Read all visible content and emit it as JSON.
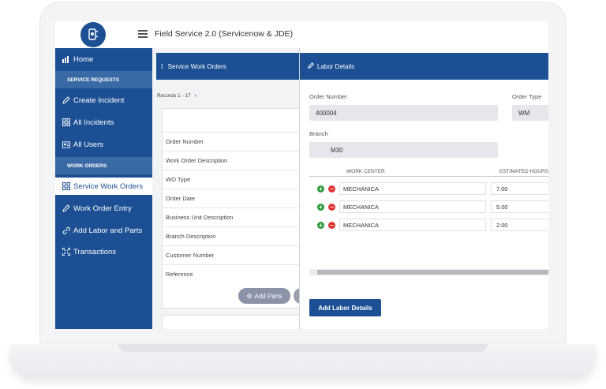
{
  "app": {
    "title": "Field Service 2.0 (Servicenow & JDE)"
  },
  "sidebar": {
    "home": "Home",
    "section_service_requests": "SERVICE REQUESTS",
    "create_incident": "Create Incident",
    "all_incidents": "All Incidents",
    "all_users": "All Users",
    "section_work_orders": "WORK ORDERS",
    "service_work_orders": "Service Work Orders",
    "work_order_entry": "Work Order Entry",
    "add_labor_parts": "Add Labor and Parts",
    "transactions": "Transactions"
  },
  "left_panel": {
    "title": "Service Work Orders",
    "records": "Records  1 - 17",
    "rows": [
      "Order Number",
      "Work Order Description",
      "WO Type",
      "Order Date",
      "Business Unit Description",
      "Branch Description",
      "Customer Number",
      "Reference"
    ],
    "add_parts": "Add Parts"
  },
  "right_panel": {
    "title": "Labor Details",
    "order_number_label": "Order Number",
    "order_number_value": "400004",
    "order_type_label": "Order Type",
    "order_type_value": "WM",
    "branch_label": "Branch",
    "branch_value": "M30",
    "columns": [
      "WORK CENTER",
      "ESTIMATED HOURS"
    ],
    "rows": [
      {
        "work_center": "MECHANICA",
        "hours": "7.00"
      },
      {
        "work_center": "MECHANICA",
        "hours": "5.00"
      },
      {
        "work_center": "MECHANICA",
        "hours": "2.00"
      }
    ],
    "add_button": "Add Labor Details"
  },
  "colors": {
    "primary": "#1c4f94",
    "section": "#3a6aa6",
    "add": "#2e9b3c",
    "remove": "#e03232"
  },
  "icons": [
    "home-icon",
    "pencil-icon",
    "grid-icon",
    "id-card-icon",
    "link-icon",
    "expand-icon",
    "gear-icon",
    "chevron-right-icon",
    "hamburger-icon"
  ]
}
